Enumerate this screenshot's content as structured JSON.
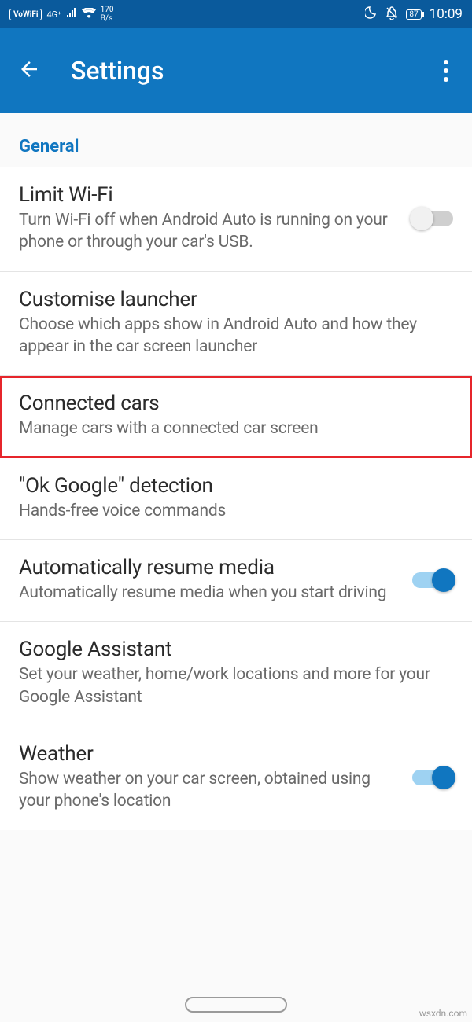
{
  "status": {
    "vowifi": "VoWiFi",
    "net": "4G⁺",
    "rate_top": "170",
    "rate_bot": "B/s",
    "battery": "87",
    "time": "10:09"
  },
  "appbar": {
    "title": "Settings"
  },
  "section": "General",
  "items": {
    "wifi": {
      "title": "Limit Wi-Fi",
      "desc": "Turn Wi-Fi off when Android Auto is running on your phone or through your car's USB."
    },
    "launch": {
      "title": "Customise launcher",
      "desc": "Choose which apps show in Android Auto and how they appear in the car screen launcher"
    },
    "cars": {
      "title": "Connected cars",
      "desc": "Manage cars with a connected car screen"
    },
    "okg": {
      "title": "\"Ok Google\" detection",
      "desc": "Hands-free voice commands"
    },
    "media": {
      "title": "Automatically resume media",
      "desc": "Automatically resume media when you start driving"
    },
    "assist": {
      "title": "Google Assistant",
      "desc": "Set your weather, home/work locations and more for your Google Assistant"
    },
    "weather": {
      "title": "Weather",
      "desc": "Show weather on your car screen, obtained using your phone's location"
    }
  },
  "watermark": "wsxdn.com"
}
